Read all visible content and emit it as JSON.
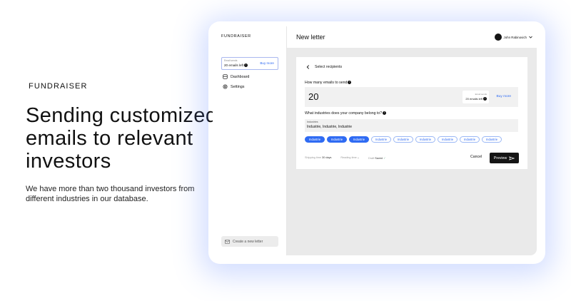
{
  "hero": {
    "brand": "FUNDRAISER",
    "headline_lines": [
      "Sending customized",
      "emails to relevant",
      "investors"
    ],
    "subtext": "We have more than two thousand investors from different industries in our database."
  },
  "sidebar": {
    "brand": "FUNDRAISER",
    "quota": {
      "label": "Email sends",
      "value": "20 emails left",
      "buy_label": "Buy more"
    },
    "items": [
      {
        "label": "Dashboard",
        "icon": "dashboard-icon"
      },
      {
        "label": "Settings",
        "icon": "gear-icon"
      }
    ],
    "create_label": "Create a new letter"
  },
  "header": {
    "title": "New letter",
    "user_name": "John Rabinovich"
  },
  "form": {
    "back_title": "Select recipients",
    "emails_question": "How many emails to send",
    "emails_count": "20",
    "mini_quota": {
      "label": "Email sends",
      "value": "20 emails left"
    },
    "buy_label": "Buy more",
    "industry_question": "What industries does your company belong to?",
    "industries_label": "Industries",
    "industries_value": "Industrie, Industrie, Industrie",
    "chips": [
      {
        "label": "Industrie",
        "active": true
      },
      {
        "label": "Industrie",
        "active": true
      },
      {
        "label": "Industrie",
        "active": true
      },
      {
        "label": "Industrie",
        "active": false
      },
      {
        "label": "Industrie",
        "active": false
      },
      {
        "label": "Industrie",
        "active": false
      },
      {
        "label": "Industrie",
        "active": false
      },
      {
        "label": "Industrie",
        "active": false
      },
      {
        "label": "Industrie",
        "active": false
      }
    ],
    "meta": {
      "shipping_label": "Shipping time",
      "shipping_value": "30 days",
      "reading_label": "Reading time",
      "reading_value": "–",
      "draft_label": "Draft",
      "draft_value": "Saved"
    },
    "cancel_label": "Cancel",
    "preview_label": "Preview"
  },
  "colors": {
    "accent": "#2f6bf3",
    "dark": "#151515",
    "panel": "#eaeaea"
  }
}
